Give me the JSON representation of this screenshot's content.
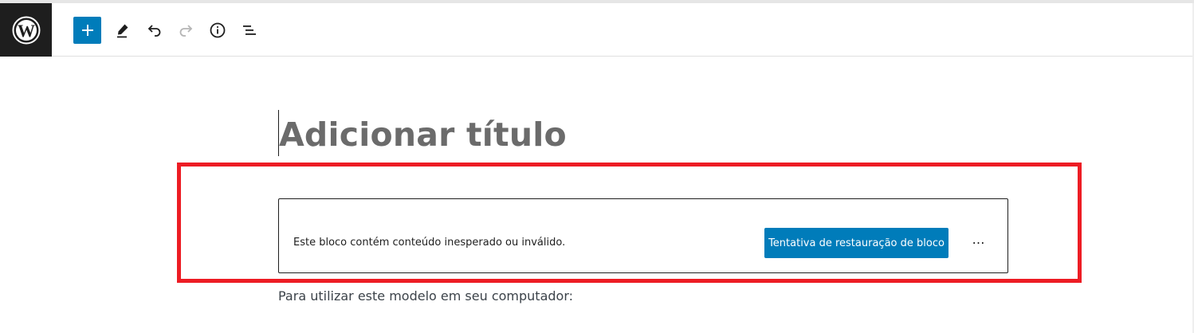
{
  "toolbar": {
    "logo_icon": "wordpress-logo-icon",
    "buttons": [
      {
        "name": "inserter-button",
        "icon": "plus-icon"
      },
      {
        "name": "tools-button",
        "icon": "pencil-icon"
      },
      {
        "name": "undo-button",
        "icon": "undo-icon"
      },
      {
        "name": "redo-button",
        "icon": "redo-icon",
        "disabled": true
      },
      {
        "name": "details-button",
        "icon": "info-icon"
      },
      {
        "name": "list-view-button",
        "icon": "list-view-icon"
      }
    ],
    "accent_color": "#007cba"
  },
  "editor": {
    "title_placeholder": "Adicionar título",
    "invalid_block": {
      "message": "Este bloco contém conteúdo inesperado ou inválido.",
      "restore_label": "Tentativa de restauração de bloco",
      "more_label": "⋯"
    },
    "paragraph": "Para utilizar este modelo em seu computador:"
  },
  "annotation": {
    "highlight_color": "#ed1c24"
  }
}
